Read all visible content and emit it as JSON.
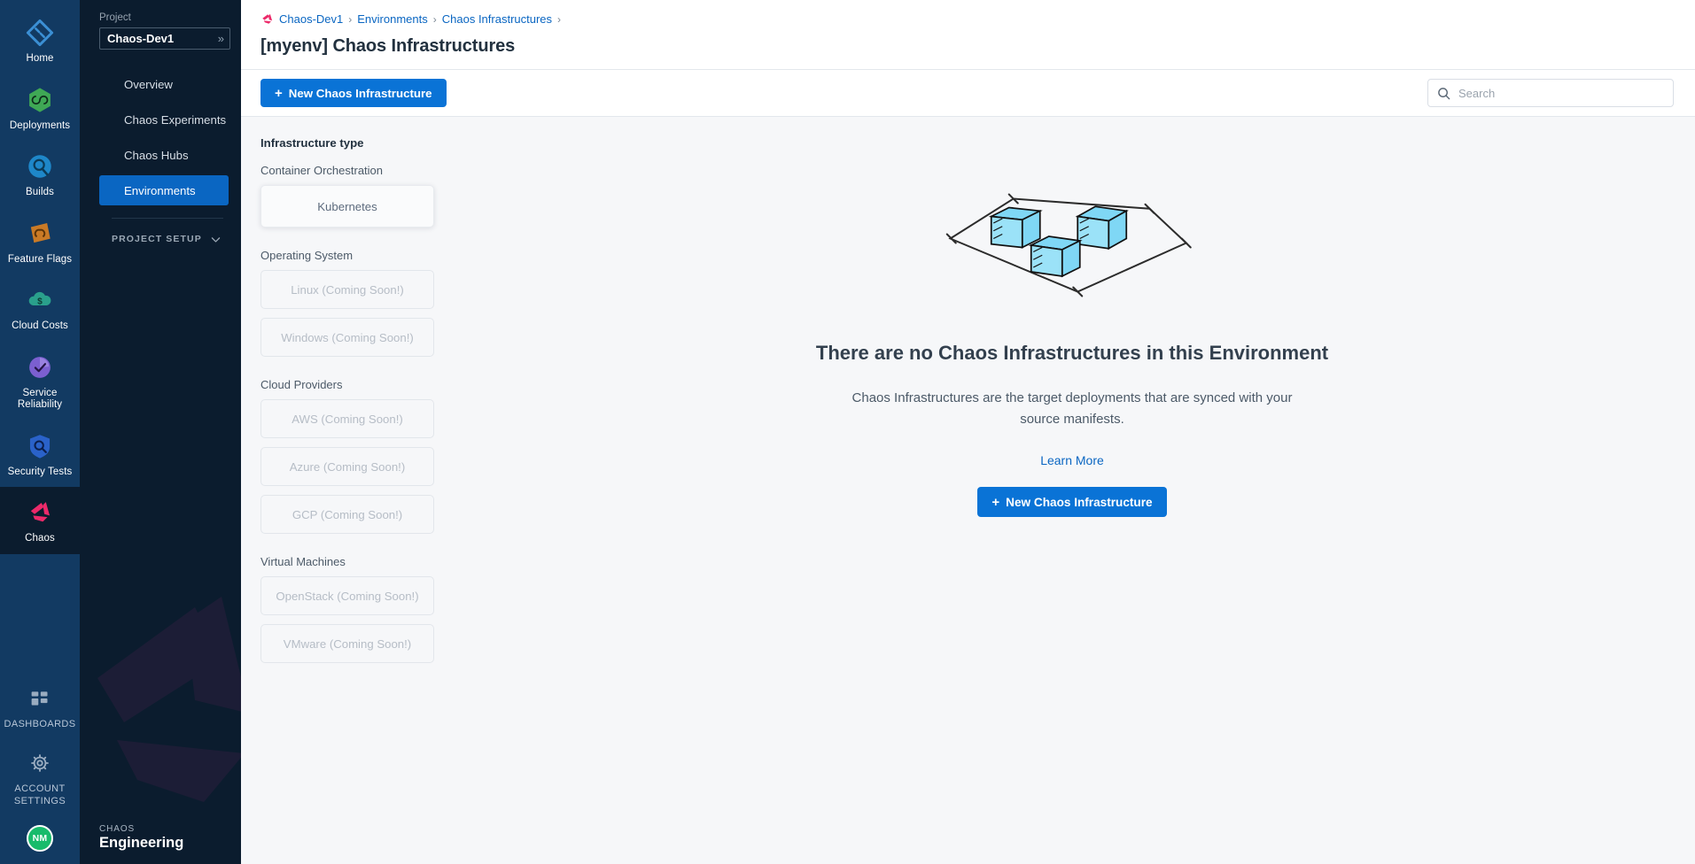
{
  "rail": {
    "items": [
      {
        "label": "Home",
        "icon": "home-icon",
        "active": false
      },
      {
        "label": "Deployments",
        "icon": "deployments-icon",
        "active": false
      },
      {
        "label": "Builds",
        "icon": "builds-icon",
        "active": false
      },
      {
        "label": "Feature Flags",
        "icon": "feature-flags-icon",
        "active": false
      },
      {
        "label": "Cloud Costs",
        "icon": "cloud-costs-icon",
        "active": false
      },
      {
        "label": "Service Reliability",
        "icon": "service-reliability-icon",
        "active": false
      },
      {
        "label": "Security Tests",
        "icon": "security-tests-icon",
        "active": false
      },
      {
        "label": "Chaos",
        "icon": "chaos-icon",
        "active": true
      }
    ],
    "bottom": [
      {
        "label": "DASHBOARDS",
        "icon": "dashboards-icon"
      },
      {
        "label": "ACCOUNT SETTINGS",
        "icon": "gear-icon"
      }
    ],
    "avatar": "NM"
  },
  "sidebar": {
    "project_label": "Project",
    "project_value": "Chaos-Dev1",
    "project_chevron": "»",
    "items": [
      {
        "label": "Overview",
        "active": false
      },
      {
        "label": "Chaos Experiments",
        "active": false
      },
      {
        "label": "Chaos Hubs",
        "active": false
      },
      {
        "label": "Environments",
        "active": true
      }
    ],
    "section_label": "PROJECT SETUP",
    "footer_top": "CHAOS",
    "footer_bottom": "Engineering"
  },
  "header": {
    "breadcrumbs": [
      "Chaos-Dev1",
      "Environments",
      "Chaos Infrastructures"
    ],
    "separator": "›",
    "title": "[myenv] Chaos Infrastructures"
  },
  "toolbar": {
    "new_button": "New Chaos Infrastructure",
    "plus": "+",
    "search_placeholder": "Search",
    "search_value": ""
  },
  "filters": {
    "title": "Infrastructure type",
    "groups": [
      {
        "label": "Container Orchestration",
        "options": [
          {
            "label": "Kubernetes",
            "state": "selected"
          }
        ]
      },
      {
        "label": "Operating System",
        "options": [
          {
            "label": "Linux (Coming Soon!)",
            "state": "disabled"
          },
          {
            "label": "Windows (Coming Soon!)",
            "state": "disabled"
          }
        ]
      },
      {
        "label": "Cloud Providers",
        "options": [
          {
            "label": "AWS (Coming Soon!)",
            "state": "disabled"
          },
          {
            "label": "Azure (Coming Soon!)",
            "state": "disabled"
          },
          {
            "label": "GCP (Coming Soon!)",
            "state": "disabled"
          }
        ]
      },
      {
        "label": "Virtual Machines",
        "options": [
          {
            "label": "OpenStack (Coming Soon!)",
            "state": "disabled"
          },
          {
            "label": "VMware (Coming Soon!)",
            "state": "disabled"
          }
        ]
      }
    ]
  },
  "empty_state": {
    "heading": "There are no Chaos Infrastructures in this Environment",
    "description": "Chaos Infrastructures are the target deployments that are synced with your source manifests.",
    "link": "Learn More",
    "button": "New Chaos Infrastructure",
    "plus": "+"
  },
  "colors": {
    "accent_blue": "#0a73d6",
    "link_blue": "#0a66c2",
    "rail_bg": "#123a62",
    "sidebar_bg": "#0b1c2e",
    "chaos_pink": "#ec2a6a",
    "cube_fill": "#7fd7f5",
    "avatar_green": "#18bb6b"
  }
}
